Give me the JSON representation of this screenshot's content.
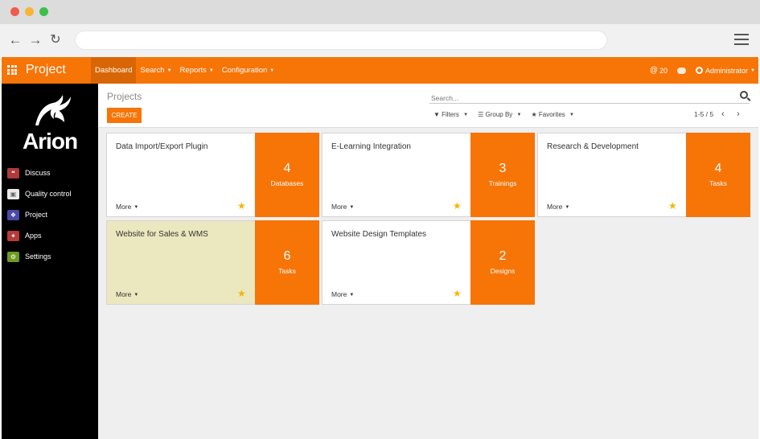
{
  "browser": {
    "address": ""
  },
  "navbar": {
    "brand": "Project",
    "menu": [
      {
        "label": "Dashboard",
        "caret": false,
        "active": true
      },
      {
        "label": "Search",
        "caret": true,
        "active": false
      },
      {
        "label": "Reports",
        "caret": true,
        "active": false
      },
      {
        "label": "Configuration",
        "caret": true,
        "active": false
      }
    ],
    "notifications": "20",
    "user": "Administrator",
    "accent_color": "#f77406"
  },
  "sidebar": {
    "logo_text": "Arion",
    "items": [
      {
        "label": "Discuss",
        "icon": "discuss-icon",
        "color": "#b03a3a"
      },
      {
        "label": "Quality control",
        "icon": "quality-control-icon",
        "color": "#e9e9e9"
      },
      {
        "label": "Project",
        "icon": "project-icon",
        "color": "#4a4aa8"
      },
      {
        "label": "Apps",
        "icon": "apps-icon",
        "color": "#b63b3b"
      },
      {
        "label": "Settings",
        "icon": "settings-icon",
        "color": "#6e9a1e"
      }
    ]
  },
  "control_panel": {
    "breadcrumb": "Projects",
    "create_label": "CREATE",
    "search_placeholder": "Search...",
    "filters": [
      "Filters",
      "Group By",
      "Favorites"
    ],
    "pager": "1-5 / 5"
  },
  "projects": [
    {
      "name": "Data Import/Export Plugin",
      "count": "4",
      "unit": "Databases",
      "more": "More",
      "highlight": false
    },
    {
      "name": "E-Learning Integration",
      "count": "3",
      "unit": "Trainings",
      "more": "More",
      "highlight": false
    },
    {
      "name": "Research & Development",
      "count": "4",
      "unit": "Tasks",
      "more": "More",
      "highlight": false
    },
    {
      "name": "Website for Sales & WMS",
      "count": "6",
      "unit": "Tasks",
      "more": "More",
      "highlight": true
    },
    {
      "name": "Website Design Templates",
      "count": "2",
      "unit": "Designs",
      "more": "More",
      "highlight": false
    }
  ]
}
